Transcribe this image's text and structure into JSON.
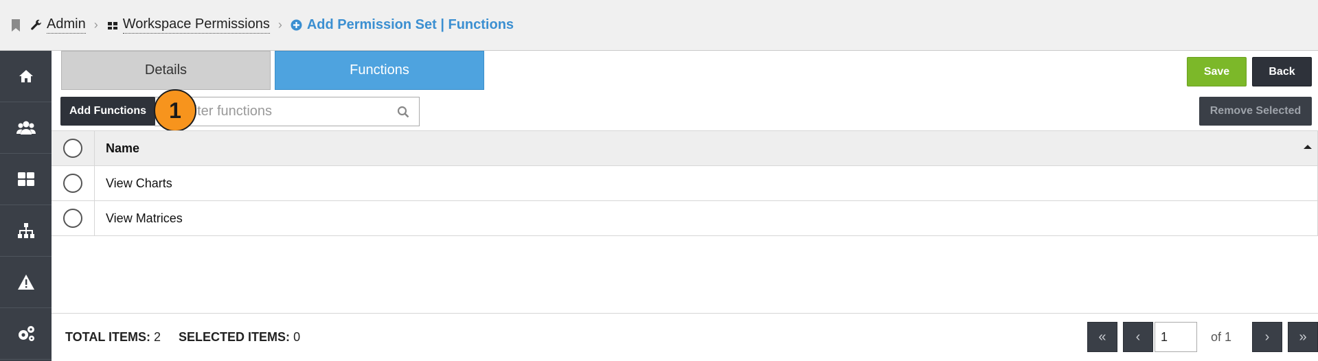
{
  "breadcrumb": {
    "admin": "Admin",
    "workspace_permissions": "Workspace Permissions",
    "current": "Add Permission Set | Functions"
  },
  "sidebar": {
    "items": [
      {
        "icon": "home-icon"
      },
      {
        "icon": "users-icon"
      },
      {
        "icon": "dashboard-icon"
      },
      {
        "icon": "hierarchy-icon"
      },
      {
        "icon": "warning-icon"
      },
      {
        "icon": "settings-icon"
      }
    ]
  },
  "tabs": {
    "details": "Details",
    "functions": "Functions"
  },
  "toolbar": {
    "save_label": "Save",
    "back_label": "Back",
    "add_functions_label": "Add Functions",
    "remove_selected_label": "Remove Selected",
    "search_placeholder": "Filter functions",
    "callout_number": "1"
  },
  "table": {
    "header": "Name",
    "rows": [
      "View Charts",
      "View Matrices"
    ]
  },
  "footer": {
    "total_items_label": "TOTAL ITEMS:",
    "total_items": "2",
    "selected_items_label": "SELECTED ITEMS:",
    "selected_items": "0",
    "page_value": "1",
    "page_of": "of 1"
  },
  "colors": {
    "accent_blue": "#4ea3df",
    "save_green": "#7cb829",
    "sidebar": "#3a3f47",
    "callout_orange": "#f7941d"
  }
}
